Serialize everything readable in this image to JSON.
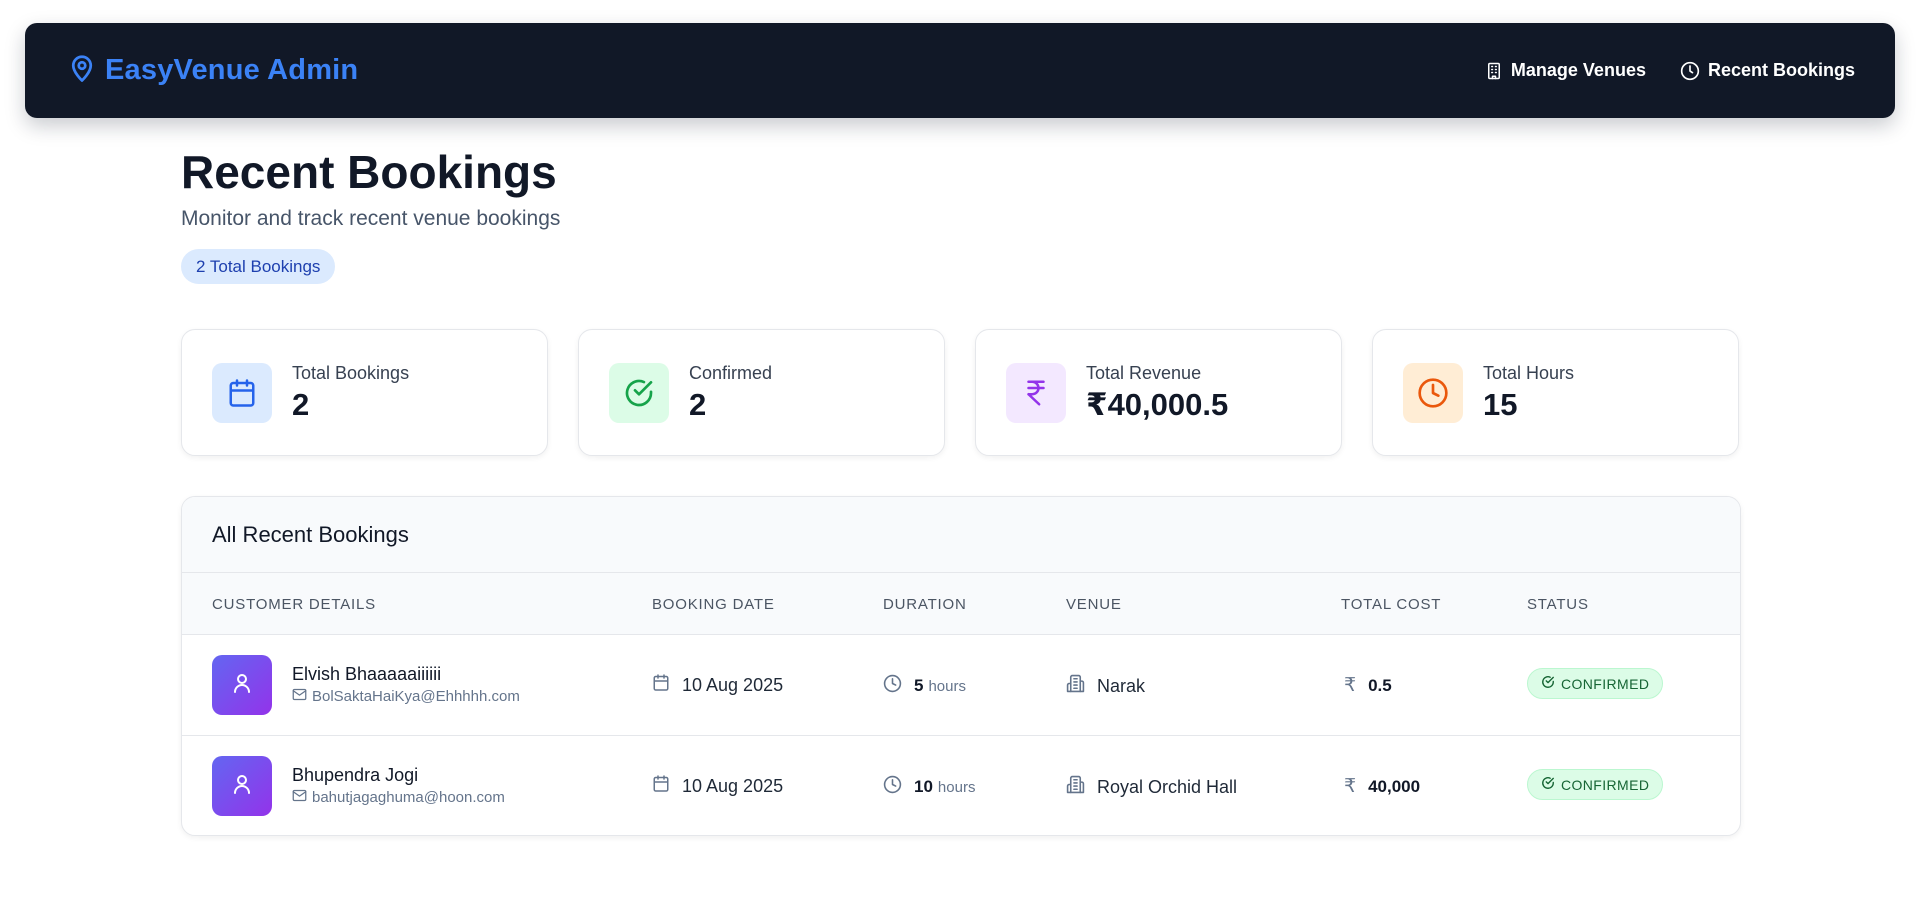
{
  "navbar": {
    "brand": "EasyVenue Admin",
    "brand_icon": "map-pin-icon",
    "links": [
      {
        "label": "Manage Venues",
        "icon": "building-icon"
      },
      {
        "label": "Recent Bookings",
        "icon": "clock-icon"
      }
    ]
  },
  "page": {
    "title": "Recent Bookings",
    "subtitle": "Monitor and track recent venue bookings",
    "count_pill": "2 Total Bookings"
  },
  "stats": [
    {
      "label": "Total Bookings",
      "value": "2",
      "icon": "calendar-icon",
      "color": "#2563eb",
      "bg": "#dbeafe"
    },
    {
      "label": "Confirmed",
      "value": "2",
      "icon": "check-circle-icon",
      "color": "#16a34a",
      "bg": "#dcfce7"
    },
    {
      "label": "Total Revenue",
      "value": "₹40,000.5",
      "icon": "rupee-icon",
      "color": "#9333ea",
      "bg": "#f3e8ff"
    },
    {
      "label": "Total Hours",
      "value": "15",
      "icon": "clock-icon",
      "color": "#ea580c",
      "bg": "#ffedd5"
    }
  ],
  "table": {
    "title": "All Recent Bookings",
    "columns": [
      "CUSTOMER DETAILS",
      "BOOKING DATE",
      "DURATION",
      "VENUE",
      "TOTAL COST",
      "STATUS"
    ],
    "rows": [
      {
        "name": "Elvish Bhaaaaaiiiiii",
        "email": "BolSaktaHaiKya@Ehhhhh.com",
        "date": "10 Aug 2025",
        "duration_value": "5",
        "duration_unit": "hours",
        "venue": "Narak",
        "cost_symbol": "₹",
        "cost": "0.5",
        "status": "CONFIRMED"
      },
      {
        "name": "Bhupendra Jogi",
        "email": "bahutjagaghuma@hoon.com",
        "date": "10 Aug 2025",
        "duration_value": "10",
        "duration_unit": "hours",
        "venue": "Royal Orchid Hall",
        "cost_symbol": "₹",
        "cost": "40,000",
        "status": "CONFIRMED"
      }
    ]
  },
  "colors": {
    "navbar_bg": "#111827",
    "brand_blue": "#3b82f6",
    "status_green_bg": "#dcfce7",
    "status_green_text": "#166534",
    "avatar_gradient": [
      "#6366f1",
      "#9333ea"
    ]
  }
}
